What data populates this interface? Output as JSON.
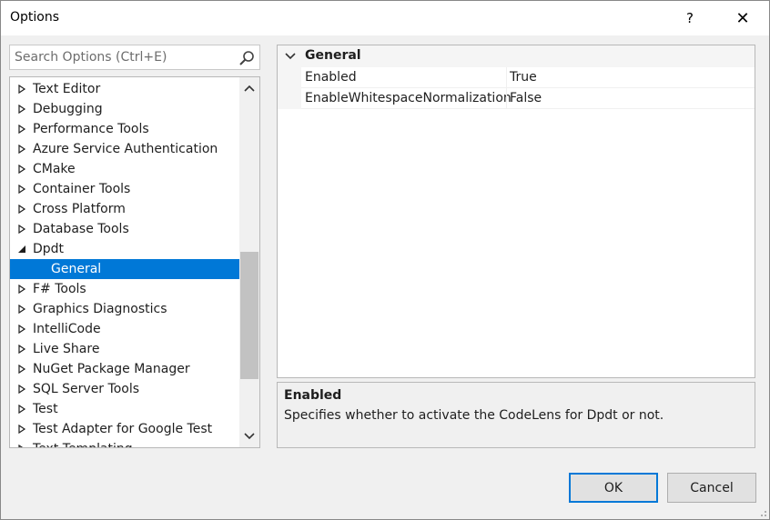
{
  "window": {
    "title": "Options",
    "help_label": "?",
    "close_label": "✕"
  },
  "search": {
    "placeholder": "Search Options (Ctrl+E)",
    "value": ""
  },
  "tree": {
    "items": [
      {
        "label": "Text Editor",
        "state": "collapsed"
      },
      {
        "label": "Debugging",
        "state": "collapsed"
      },
      {
        "label": "Performance Tools",
        "state": "collapsed"
      },
      {
        "label": "Azure Service Authentication",
        "state": "collapsed"
      },
      {
        "label": "CMake",
        "state": "collapsed"
      },
      {
        "label": "Container Tools",
        "state": "collapsed"
      },
      {
        "label": "Cross Platform",
        "state": "collapsed"
      },
      {
        "label": "Database Tools",
        "state": "collapsed"
      },
      {
        "label": "Dpdt",
        "state": "expanded"
      },
      {
        "label": "General",
        "state": "child-selected"
      },
      {
        "label": "F# Tools",
        "state": "collapsed"
      },
      {
        "label": "Graphics Diagnostics",
        "state": "collapsed"
      },
      {
        "label": "IntelliCode",
        "state": "collapsed"
      },
      {
        "label": "Live Share",
        "state": "collapsed"
      },
      {
        "label": "NuGet Package Manager",
        "state": "collapsed"
      },
      {
        "label": "SQL Server Tools",
        "state": "collapsed"
      },
      {
        "label": "Test",
        "state": "collapsed"
      },
      {
        "label": "Test Adapter for Google Test",
        "state": "collapsed"
      },
      {
        "label": "Text Templating",
        "state": "collapsed"
      }
    ]
  },
  "grid": {
    "category": "General",
    "properties": [
      {
        "name": "Enabled",
        "value": "True"
      },
      {
        "name": "EnableWhitespaceNormalization",
        "value": "False"
      }
    ]
  },
  "description": {
    "title": "Enabled",
    "text": "Specifies whether to activate the CodeLens for Dpdt or not."
  },
  "buttons": {
    "ok": "OK",
    "cancel": "Cancel"
  },
  "colors": {
    "selection": "#0078d7",
    "background": "#f0f0f0"
  }
}
